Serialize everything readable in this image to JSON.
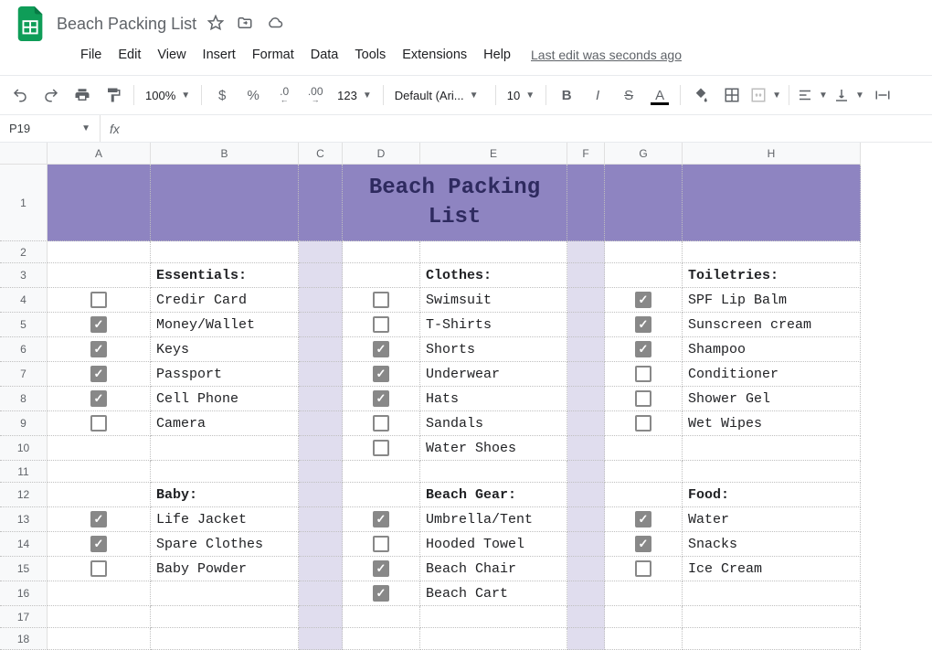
{
  "doc": {
    "title": "Beach Packing List",
    "last_edit": "Last edit was seconds ago"
  },
  "menu": {
    "file": "File",
    "edit": "Edit",
    "view": "View",
    "insert": "Insert",
    "format": "Format",
    "data": "Data",
    "tools": "Tools",
    "extensions": "Extensions",
    "help": "Help"
  },
  "toolbar": {
    "zoom": "100%",
    "currency": "$",
    "percent": "%",
    "dec_dec": ".0",
    "dec_inc": ".00",
    "more_num": "123",
    "font": "Default (Ari...",
    "size": "10",
    "bold": "B",
    "italic": "I",
    "strike": "S",
    "text_color": "A"
  },
  "namebox": {
    "value": "P19"
  },
  "cols": {
    "A": "A",
    "B": "B",
    "C": "C",
    "D": "D",
    "E": "E",
    "F": "F",
    "G": "G",
    "H": "H"
  },
  "title_cell": "Beach Packing\nList",
  "sections": {
    "essentials": {
      "header": "Essentials:",
      "items": [
        {
          "c": false,
          "t": "Credir Card"
        },
        {
          "c": true,
          "t": "Money/Wallet"
        },
        {
          "c": true,
          "t": "Keys"
        },
        {
          "c": true,
          "t": "Passport"
        },
        {
          "c": true,
          "t": "Cell Phone"
        },
        {
          "c": false,
          "t": "Camera"
        }
      ]
    },
    "clothes": {
      "header": "Clothes:",
      "items": [
        {
          "c": false,
          "t": "Swimsuit"
        },
        {
          "c": false,
          "t": "T-Shirts"
        },
        {
          "c": true,
          "t": "Shorts"
        },
        {
          "c": true,
          "t": "Underwear"
        },
        {
          "c": true,
          "t": "Hats"
        },
        {
          "c": false,
          "t": "Sandals"
        },
        {
          "c": false,
          "t": "Water Shoes"
        }
      ]
    },
    "toiletries": {
      "header": "Toiletries:",
      "items": [
        {
          "c": true,
          "t": "SPF Lip Balm"
        },
        {
          "c": true,
          "t": "Sunscreen cream"
        },
        {
          "c": true,
          "t": "Shampoo"
        },
        {
          "c": false,
          "t": "Conditioner"
        },
        {
          "c": false,
          "t": "Shower Gel"
        },
        {
          "c": false,
          "t": "Wet Wipes"
        }
      ]
    },
    "baby": {
      "header": "Baby:",
      "items": [
        {
          "c": true,
          "t": "Life Jacket"
        },
        {
          "c": true,
          "t": "Spare Clothes"
        },
        {
          "c": false,
          "t": "Baby Powder"
        }
      ]
    },
    "beachgear": {
      "header": "Beach Gear:",
      "items": [
        {
          "c": true,
          "t": "Umbrella/Tent"
        },
        {
          "c": false,
          "t": "Hooded Towel"
        },
        {
          "c": true,
          "t": "Beach Chair"
        },
        {
          "c": true,
          "t": "Beach Cart"
        }
      ]
    },
    "food": {
      "header": "Food:",
      "items": [
        {
          "c": true,
          "t": "Water"
        },
        {
          "c": true,
          "t": "Snacks"
        },
        {
          "c": false,
          "t": "Ice Cream"
        }
      ]
    }
  },
  "col_widths": {
    "A": 113,
    "B": 162,
    "C": 48,
    "D": 85,
    "E": 161,
    "F": 41,
    "G": 85,
    "H": 195
  },
  "row_heights": {
    "header": 84,
    "default": 27,
    "sm": 24
  }
}
